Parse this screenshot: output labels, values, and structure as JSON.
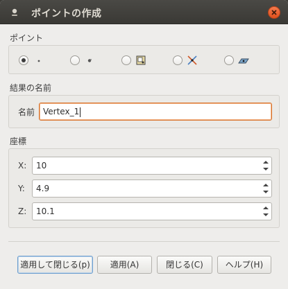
{
  "window": {
    "title": "ポイントの作成"
  },
  "point_group": {
    "label": "ポイント",
    "options": [
      {
        "icon": "point-dot-icon",
        "checked": true
      },
      {
        "icon": "point-filled-icon",
        "checked": false
      },
      {
        "icon": "point-from-shape-icon",
        "checked": false
      },
      {
        "icon": "point-intersection-icon",
        "checked": false
      },
      {
        "icon": "point-on-plane-icon",
        "checked": false
      }
    ]
  },
  "result_group": {
    "label": "結果の名前",
    "name_label": "名前",
    "name_value": "Vertex_1"
  },
  "coords_group": {
    "label": "座標",
    "x_label": "X:",
    "x_value": "10",
    "y_label": "Y:",
    "y_value": "4.9",
    "z_label": "Z:",
    "z_value": "10.1"
  },
  "buttons": {
    "apply_close": "適用して閉じる(p)",
    "apply": "適用(A)",
    "close": "閉じる(C)",
    "help": "ヘルプ(H)"
  },
  "colors": {
    "titlebar": "#3c3b37",
    "close_button": "#e95420",
    "dialog_bg": "#eeedeb",
    "focus_border": "#d9732c"
  }
}
